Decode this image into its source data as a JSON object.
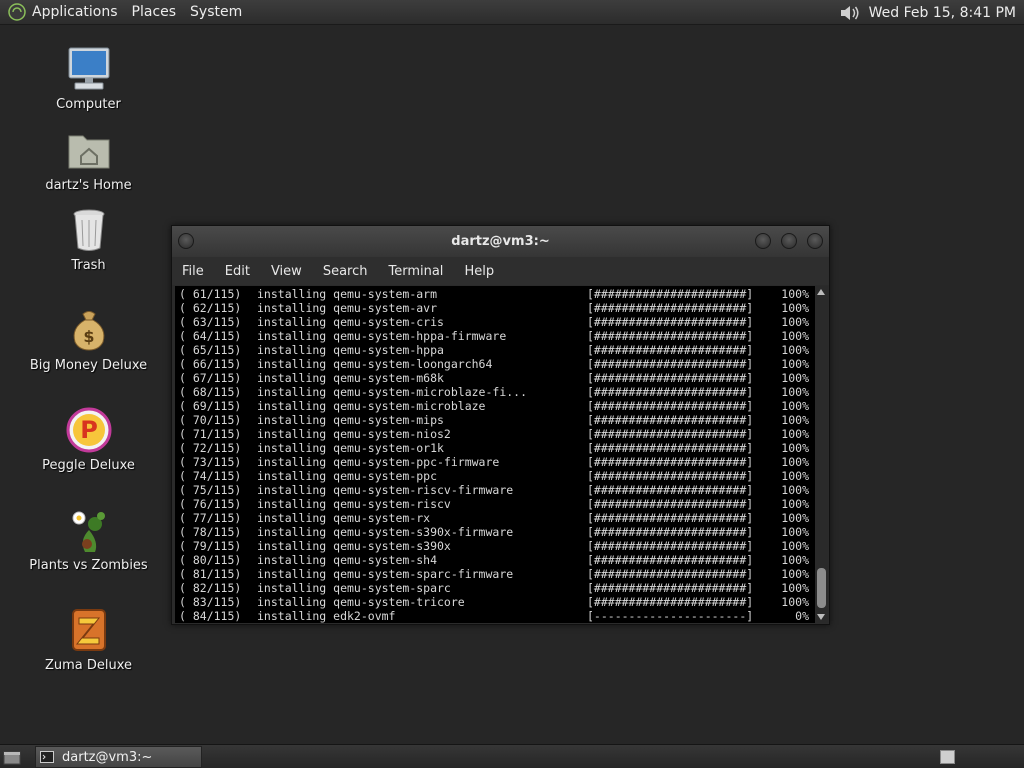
{
  "top_panel": {
    "menus": [
      "Applications",
      "Places",
      "System"
    ],
    "clock": "Wed Feb 15,  8:41 PM"
  },
  "desktop_icons": [
    {
      "label": "Computer",
      "icon": "computer-icon"
    },
    {
      "label": "dartz's Home",
      "icon": "home-folder-icon"
    },
    {
      "label": "Trash",
      "icon": "trash-icon"
    },
    {
      "label": "Big Money Deluxe",
      "icon": "big-money-icon"
    },
    {
      "label": "Peggle Deluxe",
      "icon": "peggle-icon"
    },
    {
      "label": "Plants vs Zombies",
      "icon": "plants-vs-zombies-icon"
    },
    {
      "label": "Zuma Deluxe",
      "icon": "zuma-icon"
    }
  ],
  "terminal": {
    "title": "dartz@vm3:~",
    "menus": [
      "File",
      "Edit",
      "View",
      "Search",
      "Terminal",
      "Help"
    ],
    "lines": [
      {
        "idx": "( 61/115)",
        "text": "installing qemu-system-arm",
        "bar": "[######################]",
        "pct": "100%"
      },
      {
        "idx": "( 62/115)",
        "text": "installing qemu-system-avr",
        "bar": "[######################]",
        "pct": "100%"
      },
      {
        "idx": "( 63/115)",
        "text": "installing qemu-system-cris",
        "bar": "[######################]",
        "pct": "100%"
      },
      {
        "idx": "( 64/115)",
        "text": "installing qemu-system-hppa-firmware",
        "bar": "[######################]",
        "pct": "100%"
      },
      {
        "idx": "( 65/115)",
        "text": "installing qemu-system-hppa",
        "bar": "[######################]",
        "pct": "100%"
      },
      {
        "idx": "( 66/115)",
        "text": "installing qemu-system-loongarch64",
        "bar": "[######################]",
        "pct": "100%"
      },
      {
        "idx": "( 67/115)",
        "text": "installing qemu-system-m68k",
        "bar": "[######################]",
        "pct": "100%"
      },
      {
        "idx": "( 68/115)",
        "text": "installing qemu-system-microblaze-fi...",
        "bar": "[######################]",
        "pct": "100%"
      },
      {
        "idx": "( 69/115)",
        "text": "installing qemu-system-microblaze",
        "bar": "[######################]",
        "pct": "100%"
      },
      {
        "idx": "( 70/115)",
        "text": "installing qemu-system-mips",
        "bar": "[######################]",
        "pct": "100%"
      },
      {
        "idx": "( 71/115)",
        "text": "installing qemu-system-nios2",
        "bar": "[######################]",
        "pct": "100%"
      },
      {
        "idx": "( 72/115)",
        "text": "installing qemu-system-or1k",
        "bar": "[######################]",
        "pct": "100%"
      },
      {
        "idx": "( 73/115)",
        "text": "installing qemu-system-ppc-firmware",
        "bar": "[######################]",
        "pct": "100%"
      },
      {
        "idx": "( 74/115)",
        "text": "installing qemu-system-ppc",
        "bar": "[######################]",
        "pct": "100%"
      },
      {
        "idx": "( 75/115)",
        "text": "installing qemu-system-riscv-firmware",
        "bar": "[######################]",
        "pct": "100%"
      },
      {
        "idx": "( 76/115)",
        "text": "installing qemu-system-riscv",
        "bar": "[######################]",
        "pct": "100%"
      },
      {
        "idx": "( 77/115)",
        "text": "installing qemu-system-rx",
        "bar": "[######################]",
        "pct": "100%"
      },
      {
        "idx": "( 78/115)",
        "text": "installing qemu-system-s390x-firmware",
        "bar": "[######################]",
        "pct": "100%"
      },
      {
        "idx": "( 79/115)",
        "text": "installing qemu-system-s390x",
        "bar": "[######################]",
        "pct": "100%"
      },
      {
        "idx": "( 80/115)",
        "text": "installing qemu-system-sh4",
        "bar": "[######################]",
        "pct": "100%"
      },
      {
        "idx": "( 81/115)",
        "text": "installing qemu-system-sparc-firmware",
        "bar": "[######################]",
        "pct": "100%"
      },
      {
        "idx": "( 82/115)",
        "text": "installing qemu-system-sparc",
        "bar": "[######################]",
        "pct": "100%"
      },
      {
        "idx": "( 83/115)",
        "text": "installing qemu-system-tricore",
        "bar": "[######################]",
        "pct": "100%"
      },
      {
        "idx": "( 84/115)",
        "text": "installing edk2-ovmf",
        "bar": "[----------------------]",
        "pct": "0%"
      }
    ]
  },
  "taskbar": {
    "window_button": "dartz@vm3:~"
  }
}
